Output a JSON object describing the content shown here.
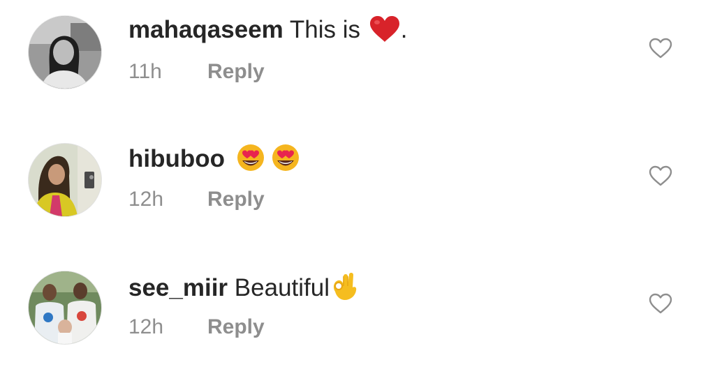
{
  "comments": [
    {
      "username": "mahaqaseem",
      "text_before": "This is",
      "emoji": "red-heart",
      "text_after": ".",
      "time": "11h",
      "reply_label": "Reply"
    },
    {
      "username": "hibuboo",
      "text_before": "",
      "emoji": "heart-eyes-x2",
      "text_after": "",
      "time": "12h",
      "reply_label": "Reply"
    },
    {
      "username": "see_miir",
      "text_before": "Beautiful",
      "emoji": "ok-hand",
      "text_after": "",
      "time": "12h",
      "reply_label": "Reply"
    }
  ],
  "colors": {
    "username": "#262626",
    "meta": "#8e8e8e",
    "like_icon": "#8e8e8e",
    "heart_emoji": "#d8232a"
  }
}
